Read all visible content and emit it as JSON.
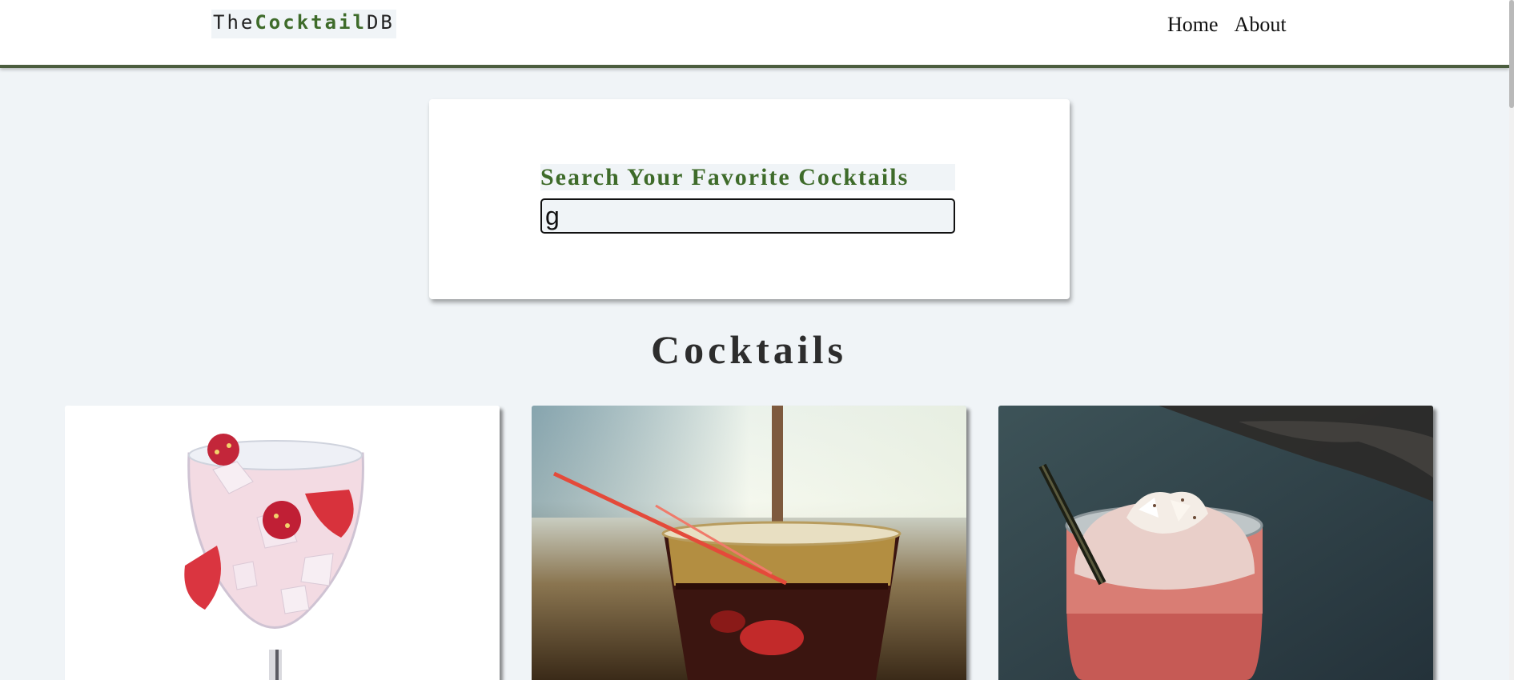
{
  "navbar": {
    "logo_prefix": "The",
    "logo_brand": "Cocktail",
    "logo_suffix": "DB",
    "links": [
      {
        "label": "Home"
      },
      {
        "label": "About"
      }
    ]
  },
  "search": {
    "label": "Search Your Favorite Cocktails",
    "value": "g"
  },
  "section": {
    "title": "Cocktails"
  },
  "cocktails": [
    {
      "image": "strawberry-gin-tonic-photo"
    },
    {
      "image": "dark-rum-cocktail-photo"
    },
    {
      "image": "pink-coconut-cocktail-photo"
    }
  ],
  "colors": {
    "accent": "#3e6b2a",
    "navbar_border": "#4b5d3e",
    "background": "#f0f4f7"
  }
}
